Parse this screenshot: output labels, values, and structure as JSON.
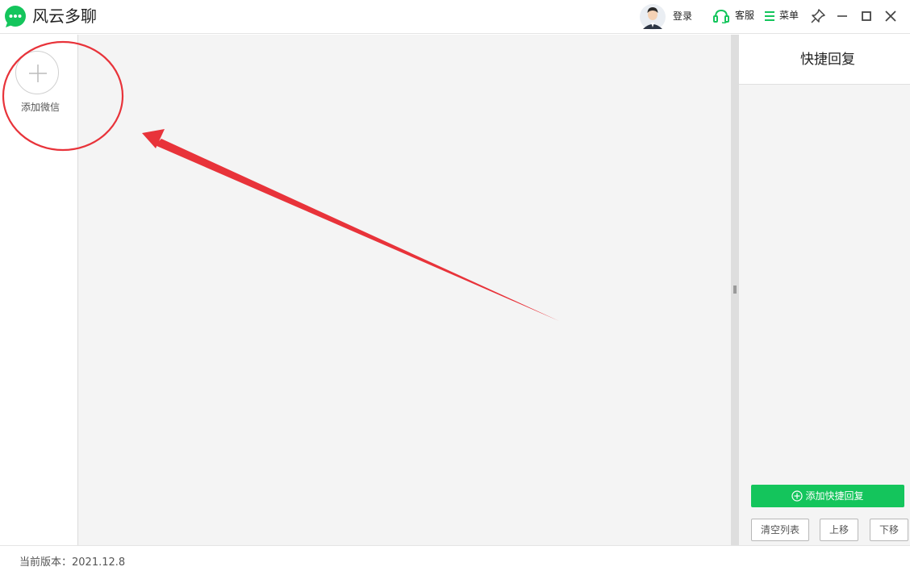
{
  "app": {
    "title": "风云多聊",
    "brand_color": "#14c55c"
  },
  "header": {
    "login_label": "登录",
    "service_label": "客服",
    "menu_label": "菜单",
    "icons": [
      "chat-logo-icon",
      "user-avatar-icon",
      "headset-icon",
      "menu-lines-icon",
      "pin-icon",
      "minimize-icon",
      "maximize-icon",
      "close-icon"
    ]
  },
  "accounts": {
    "add_label": "添加微信"
  },
  "quick_reply": {
    "title": "快捷回复",
    "add_button": "添加快捷回复",
    "clear_button": "清空列表",
    "up_button": "上移",
    "down_button": "下移"
  },
  "status": {
    "version": "当前版本：2021.12.8"
  },
  "annotation": {
    "color": "#e8333a"
  }
}
